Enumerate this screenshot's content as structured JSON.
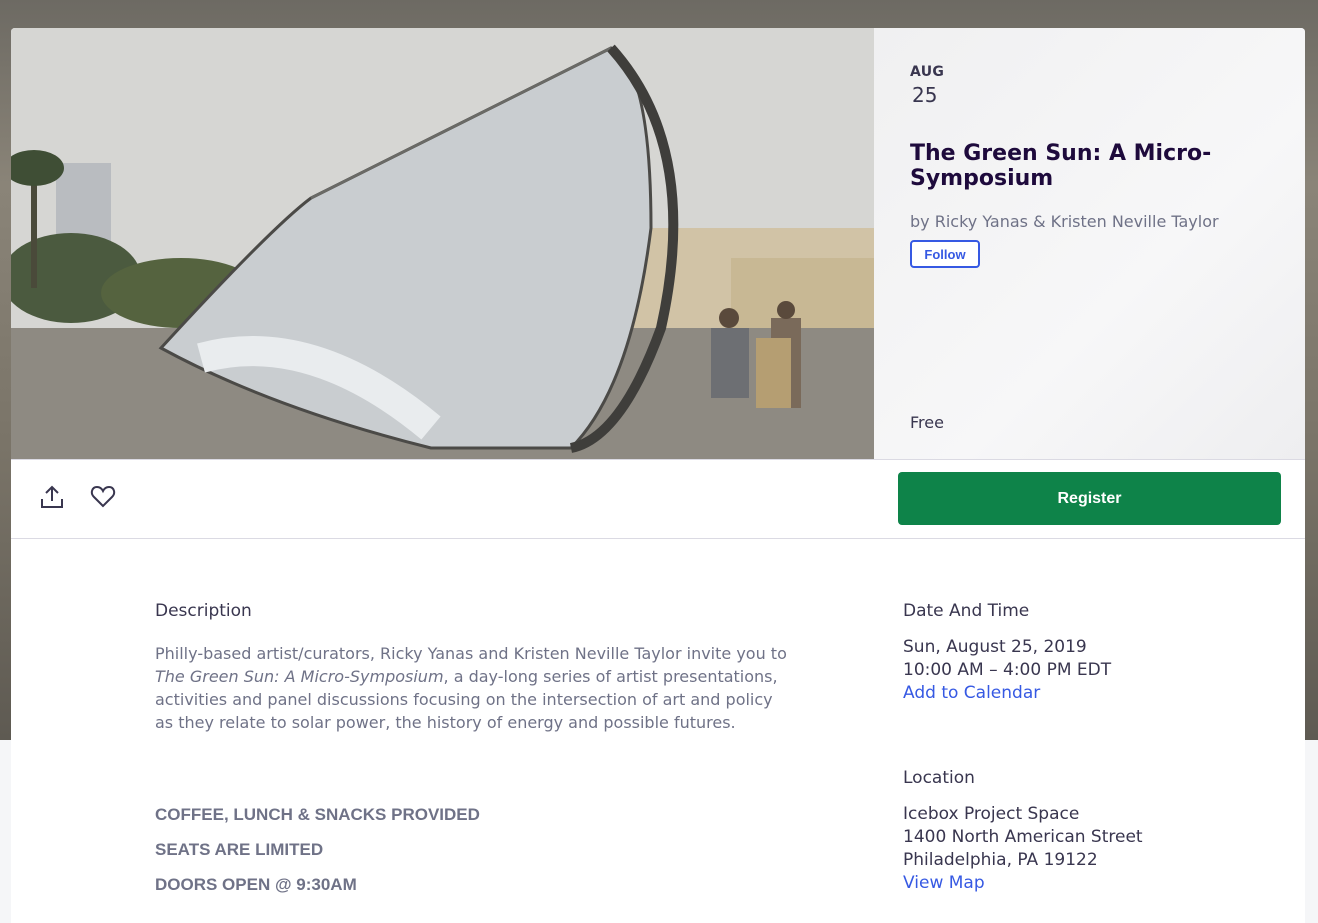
{
  "event": {
    "month": "AUG",
    "day": "25",
    "title": "The Green Sun: A Micro-Symposium",
    "organizer": "by Ricky Yanas & Kristen Neville Taylor",
    "follow_label": "Follow",
    "price": "Free"
  },
  "actions": {
    "register_label": "Register",
    "share_icon": "share-icon",
    "like_icon": "heart-icon"
  },
  "description": {
    "heading": "Description",
    "part1": "Philly-based artist/curators, Ricky Yanas and Kristen Neville Taylor invite you to ",
    "italic": "The Green Sun: A Micro-Symposium",
    "part2": ", a day-long series of artist presentations, activities and panel discussions focusing on the intersection of art and policy as they relate to solar power, the history of energy and possible futures.",
    "notes": [
      "COFFEE, LUNCH & SNACKS PROVIDED",
      "SEATS ARE LIMITED",
      "DOORS OPEN @ 9:30AM"
    ]
  },
  "datetime": {
    "heading": "Date And Time",
    "date": "Sun, August 25, 2019",
    "time": "10:00 AM – 4:00 PM EDT",
    "calendar_link": "Add to Calendar"
  },
  "location": {
    "heading": "Location",
    "venue": "Icebox Project Space",
    "street": "1400 North American Street",
    "city": "Philadelphia, PA 19122",
    "map_link": "View Map"
  },
  "colors": {
    "register_green": "#0e8349",
    "link_blue": "#3659e3",
    "title_dark": "#1e0a3c"
  }
}
